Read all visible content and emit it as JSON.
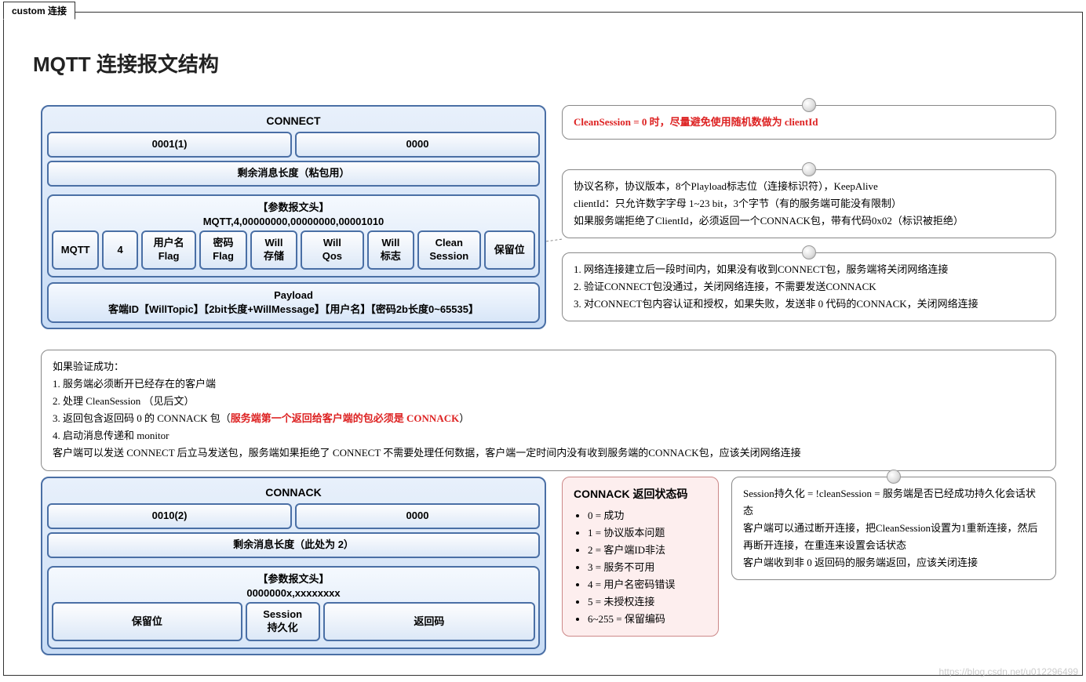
{
  "tab": "custom 连接",
  "title": "MQTT 连接报文结构",
  "connect": {
    "name": "CONNECT",
    "type_code": "0001(1)",
    "flags": "0000",
    "remaining": "剩余消息长度（粘包用）",
    "var_header_title": "【参数报文头】",
    "var_header_sub": "MQTT,4,00000000,00000000,00001010",
    "fields": [
      "MQTT",
      "4",
      "用户名\nFlag",
      "密码\nFlag",
      "Will\n存储",
      "Will\nQos",
      "Will\n标志",
      "Clean\nSession",
      "保留位"
    ],
    "payload_title": "Payload",
    "payload_sub": "客端ID【WillTopic】【2bit长度+WillMessage】【用户名】【密码2b长度0~65535】"
  },
  "note1": "CleanSession = 0 时，尽量避免使用随机数做为 clientId",
  "note2": [
    "协议名称，协议版本，8个Playload标志位（连接标识符），KeepAlive",
    "clientId：只允许数字字母 1~23 bit，3个字节（有的服务端可能没有限制）",
    "如果服务端拒绝了ClientId，必须返回一个CONNACK包，带有代码0x02（标识被拒绝）"
  ],
  "note3": [
    "1. 网络连接建立后一段时间内，如果没有收到CONNECT包，服务端将关闭网络连接",
    "2. 验证CONNECT包没通过，关闭网络连接，不需要发送CONNACK",
    "3. 对CONNECT包内容认证和授权，如果失败，发送非 0 代码的CONNACK，关闭网络连接"
  ],
  "note4": {
    "header": "如果验证成功：",
    "items": [
      "1. 服务端必须断开已经存在的客户端",
      "2. 处理 CleanSession （见后文）",
      "3. 返回包含返回码 0 的 CONNACK 包（",
      "4. 启动消息传递和 monitor"
    ],
    "item3_red": "服务端第一个返回给客户端的包必须是 CONNACK",
    "item3_tail": "）",
    "footer": "客户端可以发送 CONNECT 后立马发送包，服务端如果拒绝了 CONNECT 不需要处理任何数据，客户端一定时间内没有收到服务端的CONNACK包，应该关闭网络连接"
  },
  "connack": {
    "name": "CONNACK",
    "type_code": "0010(2)",
    "flags": "0000",
    "remaining": "剩余消息长度（此处为 2）",
    "var_header_title": "【参数报文头】",
    "var_header_sub": "0000000x,xxxxxxxx",
    "fields": [
      "保留位",
      "Session\n持久化",
      "返回码"
    ]
  },
  "codes": {
    "title": "CONNACK 返回状态码",
    "items": [
      "0 = 成功",
      "1 = 协议版本问题",
      "2 = 客户端ID非法",
      "3 = 服务不可用",
      "4 = 用户名密码错误",
      "5 = 未授权连接",
      "6~255 = 保留编码"
    ]
  },
  "note5": [
    "Session持久化 = !cleanSession = 服务端是否已经成功持久化会话状态",
    "客户端可以通过断开连接，把CleanSession设置为1重新连接，然后再断开连接，在重连来设置会话状态",
    "客户端收到非 0 返回码的服务端返回，应该关闭连接"
  ],
  "watermark": "https://blog.csdn.net/u012296499"
}
